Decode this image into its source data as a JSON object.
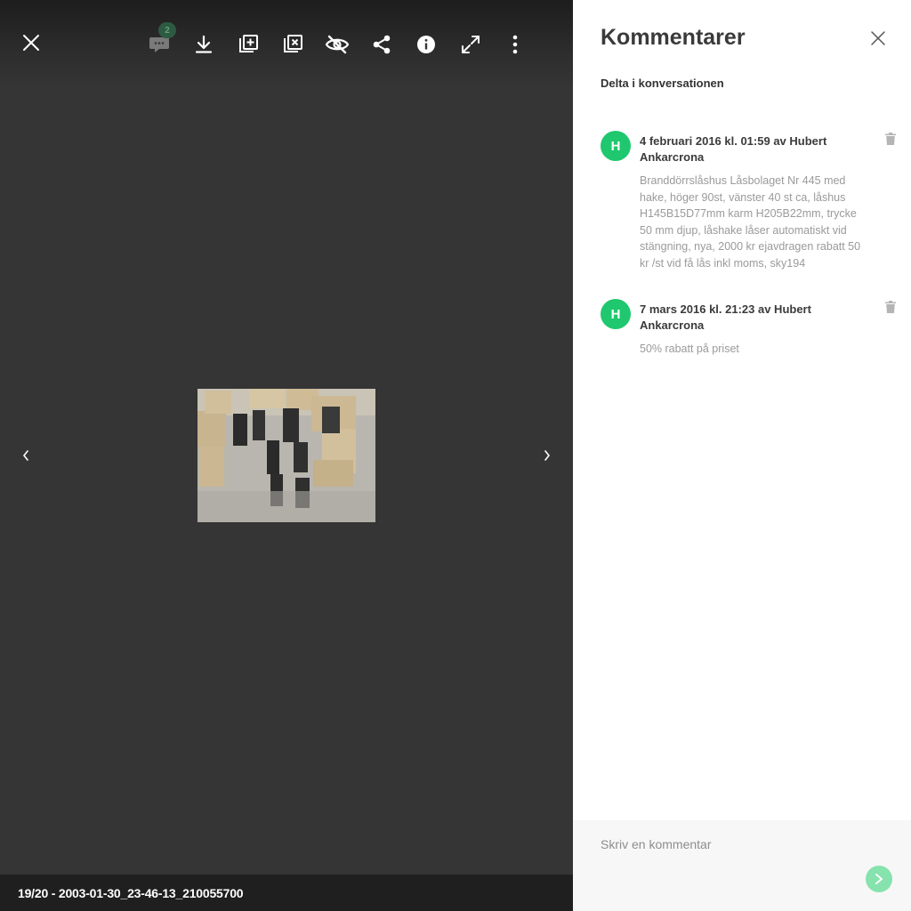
{
  "viewer": {
    "toolbar": {
      "close_icon": "close-icon",
      "comments_icon": "comment-icon",
      "comment_count": "2",
      "download_icon": "download-icon",
      "add_to_album_icon": "add-to-album-icon",
      "remove_from_album_icon": "remove-from-album-icon",
      "hide_icon": "eye-off-icon",
      "share_icon": "share-icon",
      "info_icon": "info-icon",
      "fullscreen_icon": "fullscreen-icon",
      "more_icon": "more-vertical-icon"
    },
    "prev_icon": "chevron-left-icon",
    "next_icon": "chevron-right-icon",
    "caption": "19/20 - 2003-01-30_23-46-13_210055700"
  },
  "panel": {
    "title": "Kommentarer",
    "subtitle": "Delta i konversationen",
    "comments": [
      {
        "avatar_initial": "H",
        "meta": "4 februari 2016 kl. 01:59 av Hubert Ankarcrona",
        "text": "Branddörrslåshus Låsbolaget Nr 445 med hake, höger 90st, vänster 40 st ca, låshus H145B15D77mm karm H205B22mm, trycke 50 mm djup, låshake låser automatiskt vid stängning, nya, 2000 kr ejavdragen rabatt 50 kr /st vid få lås inkl moms, sky194"
      },
      {
        "avatar_initial": "H",
        "meta": "7 mars 2016 kl. 21:23 av Hubert Ankarcrona",
        "text": "50% rabatt på priset"
      }
    ],
    "composer": {
      "placeholder": "Skriv en kommentar",
      "value": ""
    }
  },
  "colors": {
    "accent": "#1fc86e",
    "send_button": "#86e3ad",
    "viewer_bg": "#353535",
    "caption_bar": "#1f1f1f"
  }
}
